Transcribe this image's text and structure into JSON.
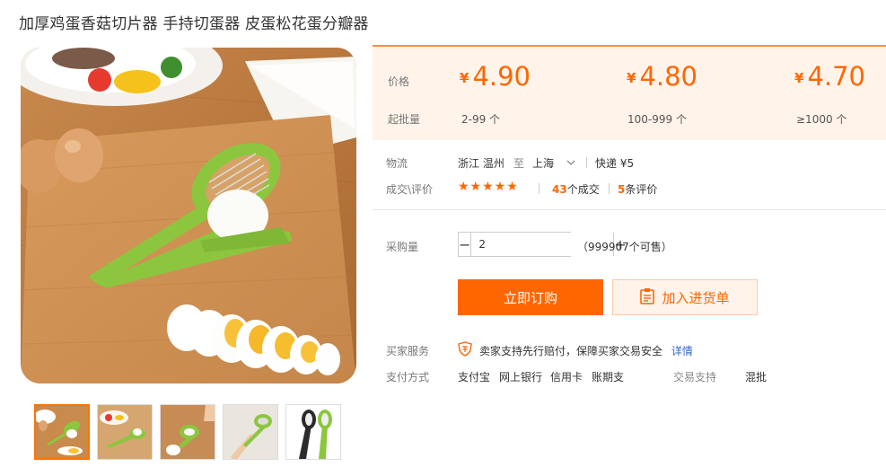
{
  "product": {
    "title": "加厚鸡蛋香菇切片器 手持切蛋器 皮蛋松花蛋分瓣器"
  },
  "price_panel": {
    "price_label": "价格",
    "moq_label": "起批量",
    "currency": "¥",
    "tiers": [
      {
        "price": "4.90",
        "range": "2-99 个"
      },
      {
        "price": "4.80",
        "range": "100-999 个"
      },
      {
        "price": "4.70",
        "range": "≥1000 个"
      }
    ]
  },
  "logistics": {
    "label": "物流",
    "origin": "浙江 温州",
    "to": "至",
    "destination": "上海",
    "express": "快递 ¥5"
  },
  "deals": {
    "label": "成交\\评价",
    "stars": "★★★★★",
    "deal_count": "43",
    "deal_suffix": "个成交",
    "review_count": "5",
    "review_suffix": "条评价"
  },
  "purchase": {
    "label": "采购量",
    "quantity": "2",
    "minus": "−",
    "plus": "+",
    "available": "（999907个可售）"
  },
  "actions": {
    "buy_now": "立即订购",
    "add_to_cart": "加入进货单"
  },
  "service": {
    "label": "买家服务",
    "text": "卖家支持先行赔付，保障买家交易安全",
    "detail_link": "详情"
  },
  "payment": {
    "label": "支付方式",
    "methods": [
      "支付宝",
      "网上银行",
      "信用卡",
      "账期支"
    ],
    "trade_label": "交易支持",
    "trade_value": "混批"
  },
  "colors": {
    "accent": "#ff6600",
    "price_bg": "#fff3ea",
    "link": "#3366cc",
    "slicer_green": "#8cc63f"
  },
  "thumbnails": [
    "slicer-with-eggs",
    "slicer-on-board-with-food",
    "slicer-hand-use",
    "slicer-held-in-hand",
    "slicer-black-and-green"
  ]
}
